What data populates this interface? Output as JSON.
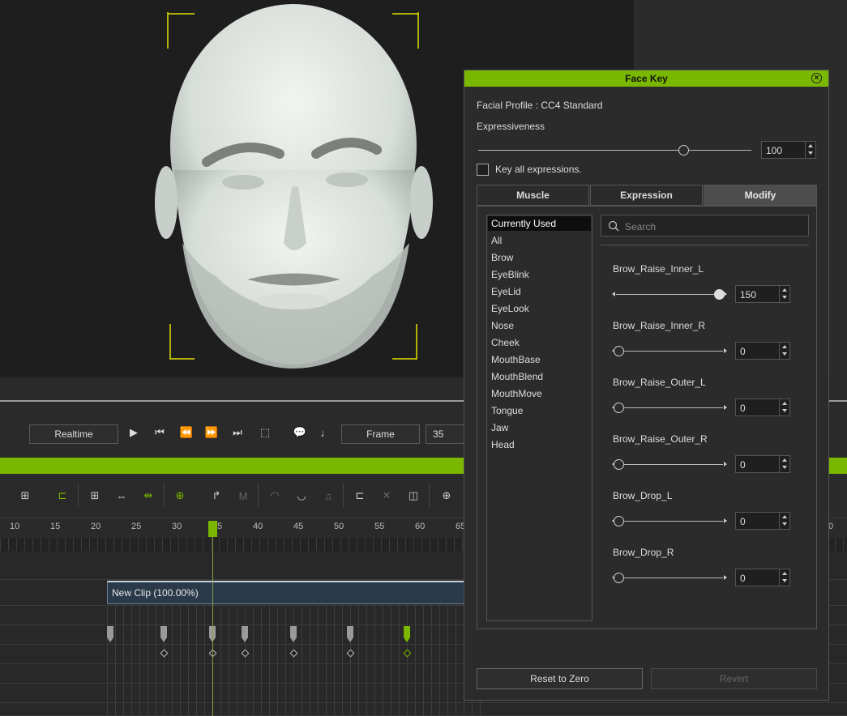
{
  "dialog": {
    "title": "Face Key",
    "facial_profile": "Facial Profile : CC4 Standard",
    "expressiveness_label": "Expressiveness",
    "expressiveness_value": "100",
    "expressiveness_fraction": 0.75,
    "key_all_label": "Key all expressions.",
    "key_all_checked": false,
    "tabs": [
      {
        "label": "Muscle",
        "active": false
      },
      {
        "label": "Expression",
        "active": false
      },
      {
        "label": "Modify",
        "active": true
      }
    ],
    "categories": [
      "Currently Used",
      "All",
      "Brow",
      "EyeBlink",
      "EyeLid",
      "EyeLook",
      "Nose",
      "Cheek",
      "MouthBase",
      "MouthBlend",
      "MouthMove",
      "Tongue",
      "Jaw",
      "Head"
    ],
    "selected_category": "Currently Used",
    "search_placeholder": "Search",
    "modifiers": [
      {
        "name": "Brow_Raise_Inner_L",
        "value": "150",
        "fraction": 1.0
      },
      {
        "name": "Brow_Raise_Inner_R",
        "value": "0",
        "fraction": 0.0
      },
      {
        "name": "Brow_Raise_Outer_L",
        "value": "0",
        "fraction": 0.0
      },
      {
        "name": "Brow_Raise_Outer_R",
        "value": "0",
        "fraction": 0.0
      },
      {
        "name": "Brow_Drop_L",
        "value": "0",
        "fraction": 0.0
      },
      {
        "name": "Brow_Drop_R",
        "value": "0",
        "fraction": 0.0
      }
    ],
    "reset_label": "Reset to Zero",
    "revert_label": "Revert"
  },
  "playback": {
    "realtime_label": "Realtime",
    "frame_mode_label": "Frame",
    "frame_value": "35"
  },
  "timeline": {
    "ruler_numbers": [
      "10",
      "15",
      "20",
      "25",
      "30",
      "5",
      "40",
      "45",
      "50",
      "55",
      "60",
      "65",
      "0"
    ],
    "clip_label": "New Clip (100.00%)"
  },
  "colors": {
    "accent": "#7ab800",
    "panel": "#2b2b2b",
    "viewport": "#1e1e1e"
  }
}
